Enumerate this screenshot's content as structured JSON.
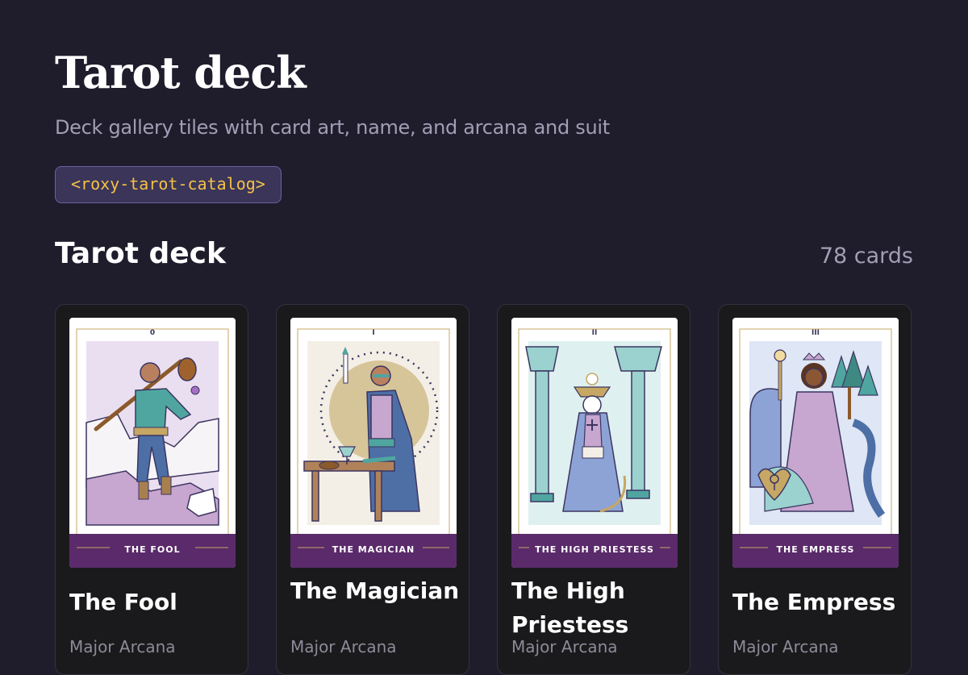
{
  "header": {
    "title": "Tarot deck",
    "subtitle": "Deck gallery tiles with card art, name, and arcana and suit",
    "tag": "<roxy-tarot-catalog>"
  },
  "section": {
    "title": "Tarot deck",
    "count_label": "78 cards"
  },
  "colors": {
    "background": "#1f1c2c",
    "tile_background": "#1a1a1c",
    "tag_text": "#f5c147",
    "card_banner": "#5a2a6a"
  },
  "cards": [
    {
      "numeral": "0",
      "banner": "THE FOOL",
      "name": "The Fool",
      "meta": "Major Arcana"
    },
    {
      "numeral": "I",
      "banner": "THE MAGICIAN",
      "name": "The Magician",
      "meta": "Major Arcana"
    },
    {
      "numeral": "II",
      "banner": "THE HIGH PRIESTESS",
      "name": "The High Priestess",
      "meta": "Major Arcana"
    },
    {
      "numeral": "III",
      "banner": "THE EMPRESS",
      "name": "The Empress",
      "meta": "Major Arcana"
    }
  ]
}
